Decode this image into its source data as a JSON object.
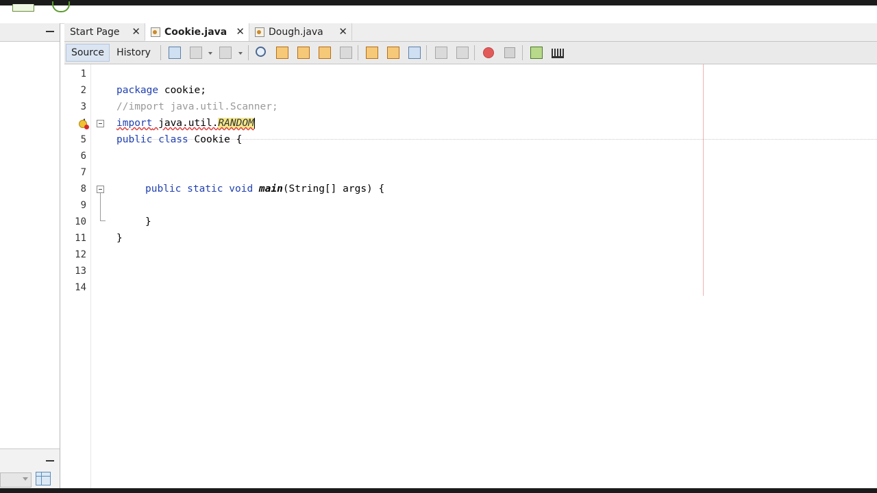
{
  "tabs": [
    {
      "label": "Start Page",
      "active": false
    },
    {
      "label": "Cookie.java",
      "active": true
    },
    {
      "label": "Dough.java",
      "active": false
    }
  ],
  "toolbar": {
    "source_label": "Source",
    "history_label": "History"
  },
  "editor": {
    "line_numbers": [
      "1",
      "2",
      "3",
      "4",
      "5",
      "6",
      "7",
      "8",
      "9",
      "10",
      "11",
      "12",
      "13",
      "14"
    ],
    "lines": {
      "l2_kw": "package",
      "l2_rest": " cookie;",
      "l3": "//import java.util.Scanner;",
      "l4_kw": "import",
      "l4_mid": " java.util.",
      "l4_hl": "RANDOM",
      "l5_kw1": "public",
      "l5_kw2": "class",
      "l5_rest": " Cookie {",
      "l8_kw1": "public",
      "l8_kw2": "static",
      "l8_kw3": "void",
      "l8_method": "main",
      "l8_rest": "(String[] args) {",
      "l10": "}",
      "l11": "}"
    }
  },
  "colors": {
    "keyword": "#1f3fb0",
    "comment": "#9a9a9a",
    "error_underline": "#e03a3a",
    "highlight": "#f3e88c"
  }
}
